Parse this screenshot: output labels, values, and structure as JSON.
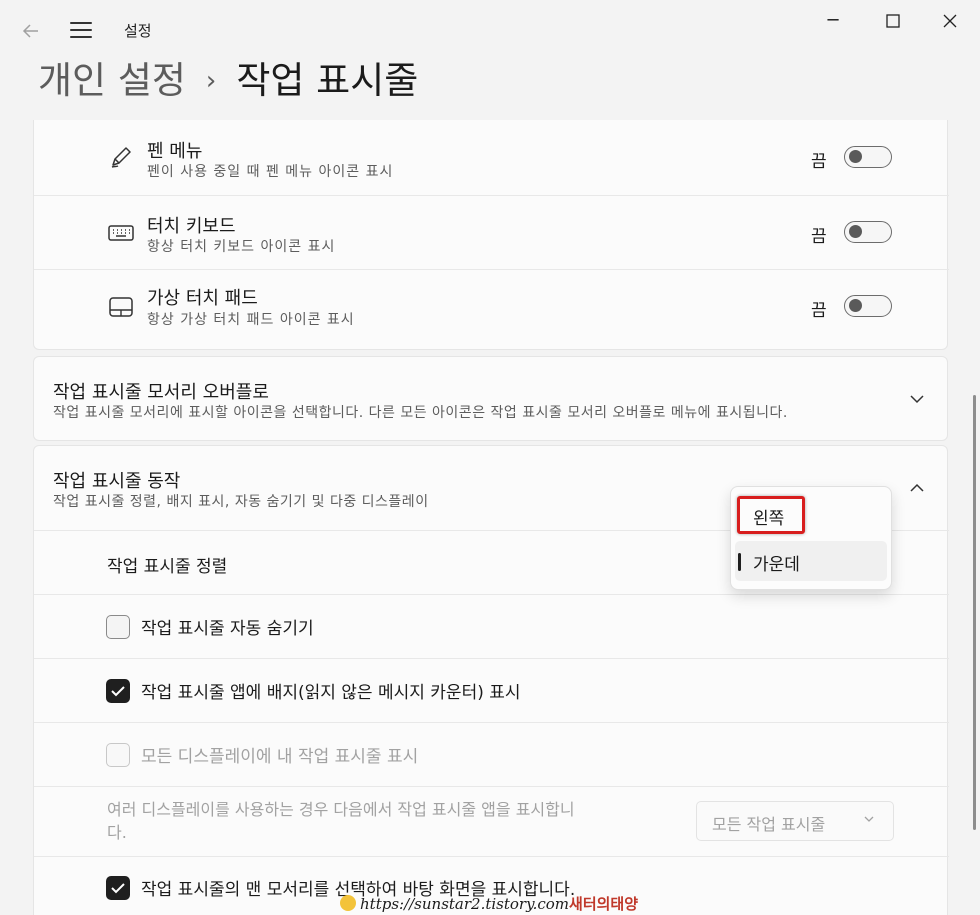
{
  "window": {
    "app_title": "설정",
    "minimize": "─",
    "maximize": "☐",
    "close": "✕"
  },
  "breadcrumb": {
    "parent": "개인 설정",
    "separator": "›",
    "current": "작업 표시줄"
  },
  "tray_icons": [
    {
      "title": "펜 메뉴",
      "subtitle": "펜이 사용 중일 때 펜 메뉴 아이콘 표시",
      "state": "끔",
      "icon": "pen-icon"
    },
    {
      "title": "터치 키보드",
      "subtitle": "항상 터치 키보드 아이콘 표시",
      "state": "끔",
      "icon": "keyboard-icon"
    },
    {
      "title": "가상 터치 패드",
      "subtitle": "항상 가상 터치 패드 아이콘 표시",
      "state": "끔",
      "icon": "touchpad-icon"
    }
  ],
  "overflow_section": {
    "title": "작업 표시줄 모서리 오버플로",
    "subtitle": "작업 표시줄 모서리에 표시할 아이콘을 선택합니다. 다른 모든 아이콘은 작업 표시줄 모서리 오버플로 메뉴에 표시됩니다."
  },
  "behaviors_section": {
    "title": "작업 표시줄 동작",
    "subtitle": "작업 표시줄 정렬, 배지 표시, 자동 숨기기 및 다중 디스플레이",
    "alignment_label": "작업 표시줄 정렬",
    "alignment_options": [
      "왼쪽",
      "가운데"
    ],
    "alignment_selected": "가운데",
    "auto_hide": {
      "label": "작업 표시줄 자동 숨기기",
      "checked": false
    },
    "badges": {
      "label": "작업 표시줄 앱에 배지(읽지 않은 메시지 카운터) 표시",
      "checked": true
    },
    "all_displays": {
      "label": "모든 디스플레이에 내 작업 표시줄 표시",
      "checked": false,
      "disabled": true
    },
    "multi_display_text": "여러 디스플레이를 사용하는 경우 다음에서 작업 표시줄 앱을 표시합니\n다.",
    "multi_display_value": "모든 작업 표시줄",
    "corner_desktop": {
      "label": "작업 표시줄의 맨 모서리를 선택하여 바탕 화면을 표시합니다.",
      "checked": true
    }
  },
  "watermark": {
    "url": "https://sunstar2.tistory.com",
    "name": "새터의태양"
  }
}
